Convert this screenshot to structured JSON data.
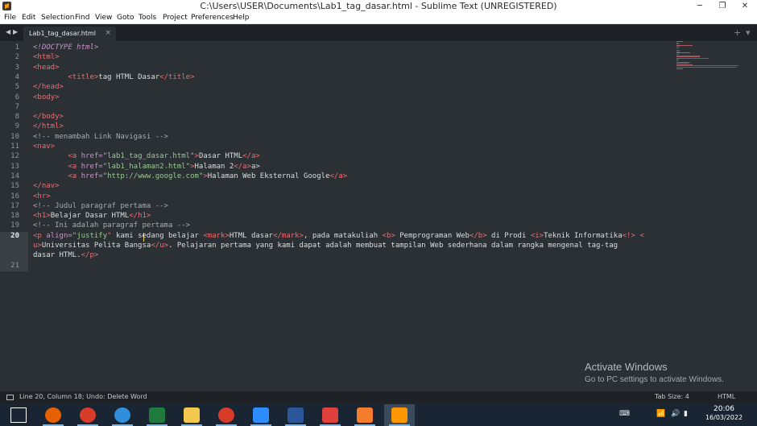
{
  "window": {
    "title": "C:\\Users\\USER\\Documents\\Lab1_tag_dasar.html - Sublime Text (UNREGISTERED)",
    "minimize": "─",
    "maximize": "❐",
    "close": "✕"
  },
  "menu": [
    "File",
    "Edit",
    "Selection",
    "Find",
    "View",
    "Goto",
    "Tools",
    "Project",
    "Preferences",
    "Help"
  ],
  "tabs": {
    "back": "◀",
    "forward": "▶",
    "active_tab": "Lab1_tag_dasar.html",
    "close": "×",
    "new_tab": "+",
    "dropdown": "▾"
  },
  "editor": {
    "line_numbers": [
      "1",
      "2",
      "3",
      "4",
      "5",
      "6",
      "7",
      "8",
      "9",
      "10",
      "11",
      "12",
      "13",
      "14",
      "15",
      "16",
      "17",
      "18",
      "19",
      "20",
      "",
      "",
      "21"
    ],
    "active_line": "20",
    "code_lines": [
      [
        [
          "doctype",
          "<!DOCTYPE html>"
        ]
      ],
      [
        [
          "tag",
          "<html>"
        ]
      ],
      [
        [
          "tag",
          "<head>"
        ]
      ],
      [
        [
          "plain",
          "        "
        ],
        [
          "tag",
          "<title>"
        ],
        [
          "plain",
          "tag HTML Dasar"
        ],
        [
          "tag",
          "</title>"
        ]
      ],
      [
        [
          "tag",
          "</head>"
        ]
      ],
      [
        [
          "tag",
          "<body>"
        ]
      ],
      [],
      [
        [
          "tag",
          "</body>"
        ]
      ],
      [
        [
          "tag",
          "</html>"
        ]
      ],
      [
        [
          "cmt",
          "<!-- menambah Link Navigasi -->"
        ]
      ],
      [
        [
          "tag",
          "<nav>"
        ]
      ],
      [
        [
          "plain",
          "        "
        ],
        [
          "tag",
          "<a "
        ],
        [
          "attr",
          "href="
        ],
        [
          "str",
          "\"lab1_tag_dasar.html\""
        ],
        [
          "tag",
          ">"
        ],
        [
          "plain",
          "Dasar HTML"
        ],
        [
          "tag",
          "</a>"
        ]
      ],
      [
        [
          "plain",
          "        "
        ],
        [
          "tag",
          "<a "
        ],
        [
          "attr",
          "href="
        ],
        [
          "str",
          "\"lab1_halaman2.html\""
        ],
        [
          "tag",
          ">"
        ],
        [
          "plain",
          "Halaman 2"
        ],
        [
          "tag",
          "</a>"
        ],
        [
          "plain",
          "a>"
        ]
      ],
      [
        [
          "plain",
          "        "
        ],
        [
          "tag",
          "<a "
        ],
        [
          "attr",
          "href="
        ],
        [
          "str",
          "\"http://www.google.com\""
        ],
        [
          "tag",
          ">"
        ],
        [
          "plain",
          "Halaman Web Eksternal Google"
        ],
        [
          "tag",
          "</a>"
        ]
      ],
      [
        [
          "tag",
          "</nav>"
        ]
      ],
      [
        [
          "tag",
          "<hr>"
        ]
      ],
      [
        [
          "cmt",
          "<!-- Judul paragraf pertama -->"
        ]
      ],
      [
        [
          "tag",
          "<h1>"
        ],
        [
          "plain",
          "Belajar Dasar HTML"
        ],
        [
          "tag",
          "</h1>"
        ]
      ],
      [
        [
          "cmt",
          "<!-- Ini adalah paragraf pertama -->"
        ]
      ],
      [
        [
          "tag",
          "<p "
        ],
        [
          "attr",
          "align="
        ],
        [
          "str",
          "\"justify"
        ],
        [
          "tag",
          "\""
        ],
        [
          "plain",
          " kami sedang belajar "
        ],
        [
          "tag",
          "<mark>"
        ],
        [
          "plain",
          "HTML dasar"
        ],
        [
          "tag",
          "</mark>"
        ],
        [
          "plain",
          ", pada matakuliah "
        ],
        [
          "tag",
          "<b>"
        ],
        [
          "plain",
          " Pemprograman Web"
        ],
        [
          "tag",
          "</b>"
        ],
        [
          "plain",
          " di Prodi "
        ],
        [
          "tag",
          "<i>"
        ],
        [
          "plain",
          "Teknik Informatika"
        ],
        [
          "tag",
          "<!>"
        ],
        [
          "plain",
          " "
        ],
        [
          "tag",
          "<"
        ]
      ],
      [
        [
          "tag",
          "u>"
        ],
        [
          "plain",
          "Universitas Pelita Bangsa"
        ],
        [
          "tag",
          "</u>"
        ],
        [
          "plain",
          ". Pelajaran pertama yang kami dapat adalah membuat tampilan Web sederhana dalam rangka mengenal tag-tag"
        ]
      ],
      [
        [
          "plain",
          "dasar HTML."
        ],
        [
          "tag",
          "</p>"
        ]
      ],
      []
    ]
  },
  "watermark": {
    "title": "Activate Windows",
    "subtitle": "Go to PC settings to activate Windows."
  },
  "status": {
    "left": "Line 20, Column 18; Undo: Delete Word",
    "tab_size": "Tab Size: 4",
    "syntax": "HTML"
  },
  "taskbar": {
    "apps": [
      {
        "name": "windows-start",
        "color": "#ffffff"
      },
      {
        "name": "firefox",
        "color": "#e66000"
      },
      {
        "name": "chrome",
        "color": "#d93b2b"
      },
      {
        "name": "edge",
        "color": "#2f8fdc"
      },
      {
        "name": "excel",
        "color": "#1f7a3b"
      },
      {
        "name": "file-explorer",
        "color": "#f2c94c"
      },
      {
        "name": "chrome-2",
        "color": "#d93b2b"
      },
      {
        "name": "zoom",
        "color": "#2d8cff"
      },
      {
        "name": "word",
        "color": "#2b579a"
      },
      {
        "name": "star-app",
        "color": "#e0413c"
      },
      {
        "name": "xampp",
        "color": "#f57c2c"
      },
      {
        "name": "sublime-text",
        "color": "#ff9800"
      }
    ],
    "tray": {
      "keyboard": "⌨",
      "wifi": "📶",
      "volume": "🔊",
      "battery": "▮",
      "clock_time": "20:06",
      "clock_date": "16/03/2022"
    }
  }
}
